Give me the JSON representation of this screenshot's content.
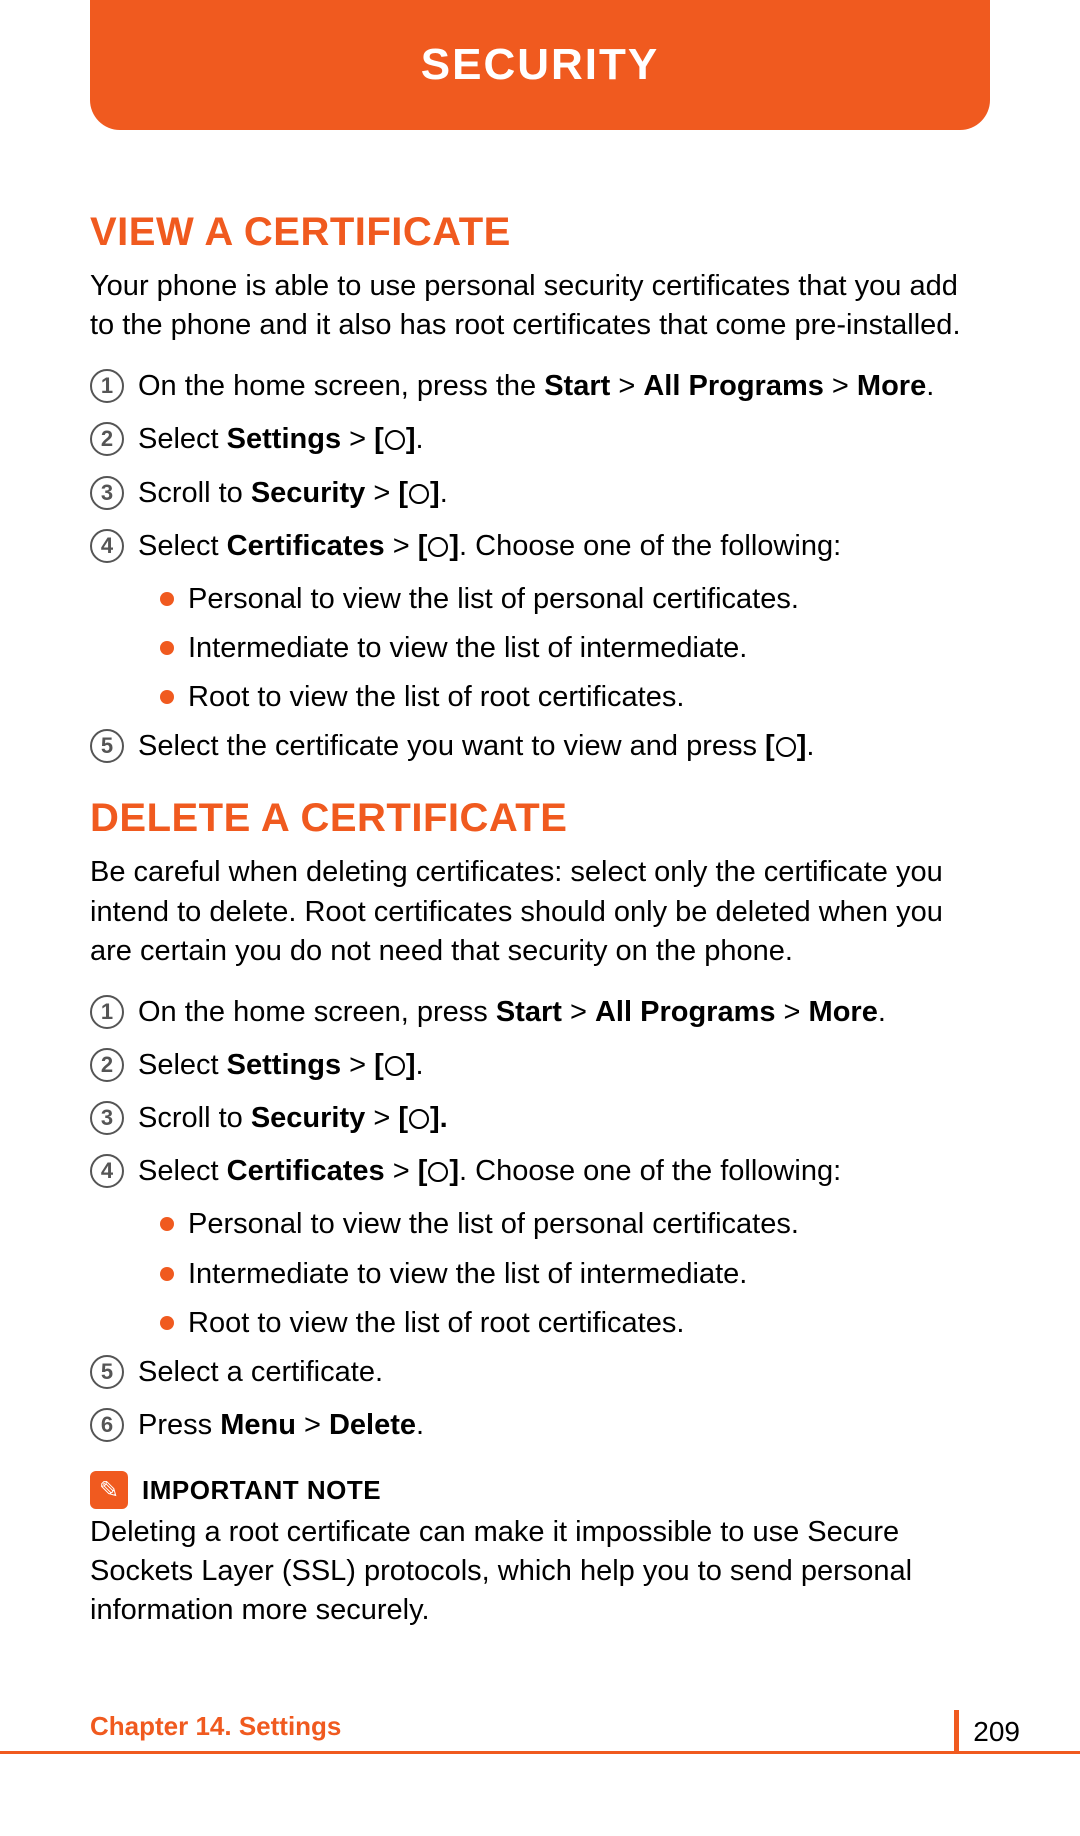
{
  "header": {
    "title": "SECURITY"
  },
  "section1": {
    "heading": "VIEW A CERTIFICATE",
    "intro": "Your phone is able to use personal security certificates that you add to the phone and it also has root certificates that come pre-installed.",
    "steps": {
      "s1_a": "On the home screen, press the ",
      "s1_b": "Start",
      "s1_c": " > ",
      "s1_d": "All Programs",
      "s1_e": " > ",
      "s1_f": "More",
      "s1_g": ".",
      "s2_a": "Select ",
      "s2_b": "Settings",
      "s2_c": " > ",
      "s2_d": "[",
      "s2_e": "]",
      "s2_f": ".",
      "s3_a": "Scroll to ",
      "s3_b": "Security",
      "s3_c": " > ",
      "s3_d": "[",
      "s3_e": "]",
      "s3_f": ".",
      "s4_a": "Select ",
      "s4_b": "Certificates",
      "s4_c": " > ",
      "s4_d": "[",
      "s4_e": "]",
      "s4_f": ". Choose one of the following:",
      "s4_sub1": "Personal to view the list of personal certificates.",
      "s4_sub2": "Intermediate to view the list of intermediate.",
      "s4_sub3": "Root to view the list of root certificates.",
      "s5_a": "Select the certificate you want to view and press ",
      "s5_b": "[",
      "s5_c": "]",
      "s5_d": "."
    }
  },
  "section2": {
    "heading": "DELETE A CERTIFICATE",
    "intro": "Be careful when deleting certificates: select only the certificate you intend to delete. Root certificates should only be deleted when you are certain you do not need that security on the phone.",
    "steps": {
      "s1_a": "On the home screen, press ",
      "s1_b": "Start",
      "s1_c": " > ",
      "s1_d": "All Programs",
      "s1_e": " > ",
      "s1_f": "More",
      "s1_g": ".",
      "s2_a": "Select ",
      "s2_b": "Settings",
      "s2_c": " > ",
      "s2_d": "[",
      "s2_e": "]",
      "s2_f": ".",
      "s3_a": "Scroll to ",
      "s3_b": "Security",
      "s3_c": " > ",
      "s3_d": "[",
      "s3_e": "].",
      "s4_a": "Select ",
      "s4_b": "Certificates",
      "s4_c": " > ",
      "s4_d": "[",
      "s4_e": "]",
      "s4_f": ". Choose one of the following:",
      "s4_sub1": "Personal to view the list of personal certificates.",
      "s4_sub2": "Intermediate to view the list of intermediate.",
      "s4_sub3": "Root to view the list of root certificates.",
      "s5": "Select a certificate.",
      "s6_a": "Press ",
      "s6_b": "Menu",
      "s6_c": " > ",
      "s6_d": "Delete",
      "s6_e": "."
    }
  },
  "note": {
    "title": "IMPORTANT NOTE",
    "body": "Deleting a root certificate can make it impossible to use Secure Sockets Layer (SSL) protocols, which help you to send personal information more securely."
  },
  "footer": {
    "chapter": "Chapter 14. Settings",
    "page": "209"
  },
  "nums": {
    "n1": "1",
    "n2": "2",
    "n3": "3",
    "n4": "4",
    "n5": "5",
    "n6": "6"
  }
}
